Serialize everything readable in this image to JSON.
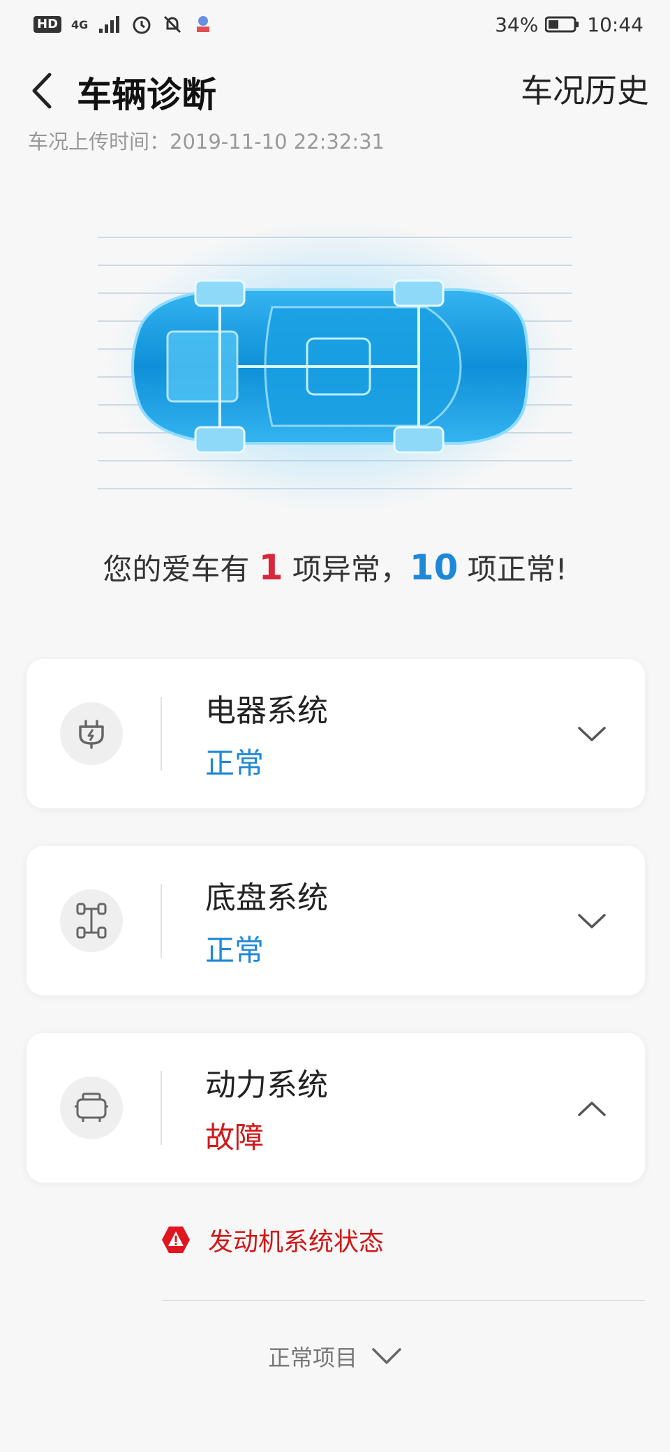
{
  "statusbar": {
    "hd": "HD",
    "network": "4G",
    "battery": "34%",
    "time": "10:44"
  },
  "header": {
    "title": "车辆诊断",
    "history": "车况历史"
  },
  "upload_time": "车况上传时间：2019-11-10 22:32:31",
  "summary": {
    "prefix": "您的爱车有 ",
    "abnormal_count": "1",
    "middle": " 项异常，",
    "normal_count": "10",
    "suffix": " 项正常!"
  },
  "systems": [
    {
      "title": "电器系统",
      "status": "正常",
      "icon": "plug-icon",
      "expanded": false
    },
    {
      "title": "底盘系统",
      "status": "正常",
      "icon": "chassis-icon",
      "expanded": false
    },
    {
      "title": "动力系统",
      "status": "故障",
      "icon": "engine-icon",
      "expanded": true
    }
  ],
  "fault": {
    "label": "发动机系统状态",
    "icon": "warning-icon"
  },
  "normal_items": {
    "label": "正常项目"
  },
  "colors": {
    "accent_blue": "#1e88d8",
    "fault_red": "#d01818",
    "count_red": "#d8263a",
    "background": "#f7f7f7"
  }
}
